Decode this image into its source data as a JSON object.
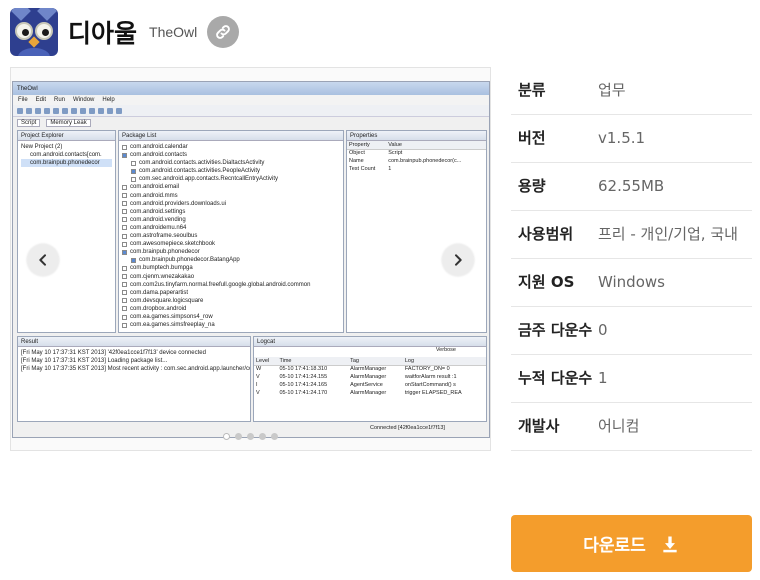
{
  "app": {
    "name": "디아울",
    "sub": "TheOwl",
    "icon": "owl-app-icon"
  },
  "carousel": {
    "slide_count": 5,
    "active_index": 0,
    "screenshot": {
      "window_title": "TheOwl",
      "menu": [
        "File",
        "Edit",
        "Run",
        "Window",
        "Help"
      ],
      "perspective_tabs": [
        "Script",
        "Memory Leak"
      ],
      "project_explorer": {
        "title": "Project Explorer",
        "root": "New Project (2)",
        "items": [
          "com.android.contacts[com.",
          "com.brainpub.phonedecor"
        ]
      },
      "package_list": {
        "title": "Package List",
        "rows": [
          {
            "label": "com.android.calendar",
            "checked": false,
            "indent": false
          },
          {
            "label": "com.android.contacts",
            "checked": true,
            "indent": false
          },
          {
            "label": "com.android.contacts.activities.DialtactsActivity",
            "checked": false,
            "indent": true
          },
          {
            "label": "com.android.contacts.activities.PeopleActivity",
            "checked": true,
            "indent": true
          },
          {
            "label": "com.sec.android.app.contacts.RecntcallEntryActivity",
            "checked": false,
            "indent": true
          },
          {
            "label": "com.android.email",
            "checked": false,
            "indent": false
          },
          {
            "label": "com.android.mms",
            "checked": false,
            "indent": false
          },
          {
            "label": "com.android.providers.downloads.ui",
            "checked": false,
            "indent": false
          },
          {
            "label": "com.android.settings",
            "checked": false,
            "indent": false
          },
          {
            "label": "com.android.vending",
            "checked": false,
            "indent": false
          },
          {
            "label": "com.androidemu.n64",
            "checked": false,
            "indent": false
          },
          {
            "label": "com.astroframe.seoulbus",
            "checked": false,
            "indent": false
          },
          {
            "label": "com.awesomepiece.sketchbook",
            "checked": false,
            "indent": false
          },
          {
            "label": "com.brainpub.phonedecor",
            "checked": true,
            "indent": false
          },
          {
            "label": "com.brainpub.phonedecor.BatangApp",
            "checked": true,
            "indent": true
          },
          {
            "label": "com.bumptech.bumpga",
            "checked": false,
            "indent": false
          },
          {
            "label": "com.cjenm.wnezakakao",
            "checked": false,
            "indent": false
          },
          {
            "label": "com.com2us.tinyfarm.normal.freefull.google.global.android.common",
            "checked": false,
            "indent": false
          },
          {
            "label": "com.dama.paperartist",
            "checked": false,
            "indent": false
          },
          {
            "label": "com.devsquare.logicsquare",
            "checked": false,
            "indent": false
          },
          {
            "label": "com.dropbox.android",
            "checked": false,
            "indent": false
          },
          {
            "label": "com.ea.games.simpsons4_row",
            "checked": false,
            "indent": false
          },
          {
            "label": "com.ea.games.simsfreeplay_na",
            "checked": false,
            "indent": false
          }
        ]
      },
      "properties": {
        "title": "Properties",
        "headers": [
          "Property",
          "Value"
        ],
        "rows": [
          [
            "Object",
            "Script"
          ],
          [
            "Name",
            "com.brainpub.phonedecor(c..."
          ],
          [
            "Test Count",
            "1"
          ]
        ]
      },
      "result": {
        "title": "Result",
        "lines": [
          "[Fri May 10 17:37:31 KST 2013] '42f0ea1cce1f7f13' device connected",
          "[Fri May 10 17:37:31 KST 2013] Loading package list...",
          "[Fri May 10 17:37:35 KST 2013] Most recent activity : com.sec.android.app.launcher/com.a"
        ]
      },
      "logcat": {
        "title": "Logcat",
        "filter": "Verbose",
        "headers": [
          "Level",
          "Time",
          "Tag",
          "Log"
        ],
        "rows": [
          [
            "W",
            "05-10 17:41:18.310",
            "AlarmManager",
            "FACTORY_ON= 0"
          ],
          [
            "V",
            "05-10 17:41:24.155",
            "AlarmManager",
            "waitforAlarm result :1"
          ],
          [
            "I",
            "05-10 17:41:24.165",
            "AgentService",
            "onStartCommand() s"
          ],
          [
            "V",
            "05-10 17:41:24.170",
            "AlarmManager",
            "trigger ELAPSED_REA"
          ]
        ]
      },
      "status": "Connected [42f0ea1cce1f7f13]"
    }
  },
  "info": [
    {
      "label": "분류",
      "value": "업무"
    },
    {
      "label": "버전",
      "value": "v1.5.1"
    },
    {
      "label": "용량",
      "value": "62.55MB"
    },
    {
      "label": "사용범위",
      "value": "프리 - 개인/기업, 국내"
    },
    {
      "label": "지원 OS",
      "value": "Windows"
    },
    {
      "label": "금주 다운수",
      "value": "0"
    },
    {
      "label": "누적 다운수",
      "value": "1"
    },
    {
      "label": "개발사",
      "value": "어니컴"
    }
  ],
  "download": {
    "label": "다운로드",
    "icon": "download-icon"
  },
  "colors": {
    "accent": "#f49d2c",
    "link_button": "#a9a9a9",
    "value_text": "#666666"
  }
}
